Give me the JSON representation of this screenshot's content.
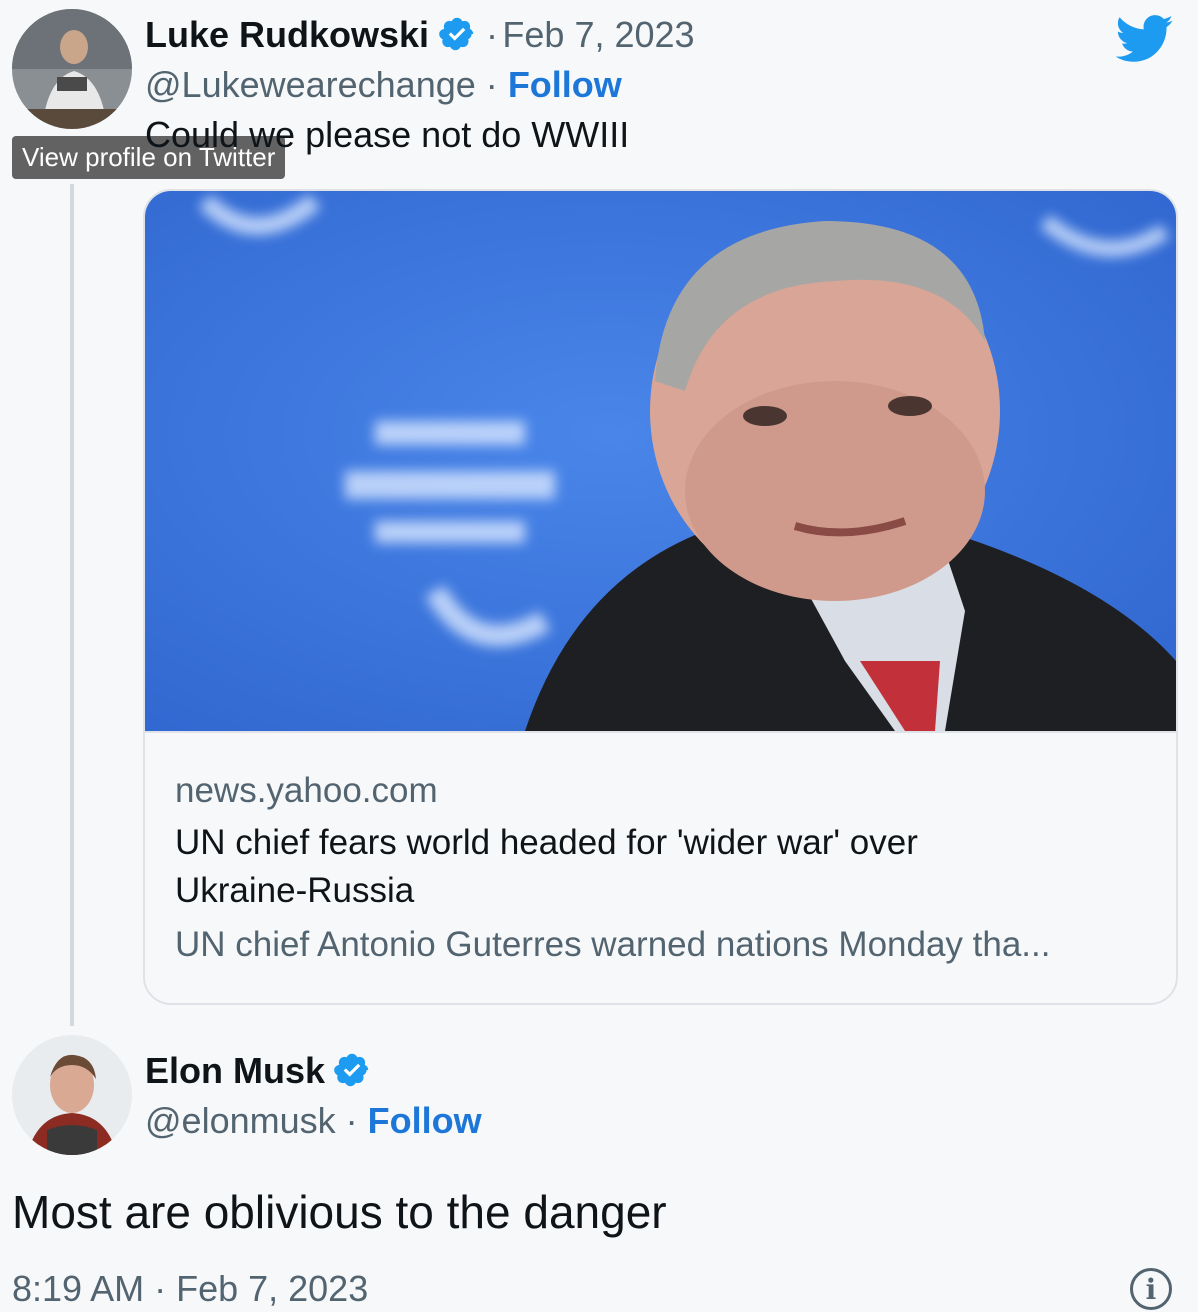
{
  "parent_tweet": {
    "author_name": "Luke Rudkowski",
    "separator_date": "·",
    "date": "Feb 7, 2023",
    "handle": "@Lukewearechange",
    "separator_follow": "·",
    "follow_label": "Follow",
    "text": "Could we please not do WWIII",
    "tooltip": "View profile on Twitter"
  },
  "link_card": {
    "domain": "news.yahoo.com",
    "title": "UN chief fears world headed for 'wider war' over Ukraine-Russia",
    "description": "UN chief Antonio Guterres warned nations Monday tha..."
  },
  "reply_tweet": {
    "author_name": "Elon Musk",
    "handle": "@elonmusk",
    "separator_follow": "·",
    "follow_label": "Follow",
    "text": "Most are oblivious to the danger",
    "timestamp": "8:19 AM · Feb 7, 2023"
  },
  "icons": {
    "brand": "twitter-bird-icon",
    "verified": "verified-badge-icon",
    "info": "info-icon"
  },
  "colors": {
    "accent": "#1d9bf0",
    "follow": "#1d77d8",
    "muted": "#536471",
    "image_bg": "#3f78e0"
  }
}
